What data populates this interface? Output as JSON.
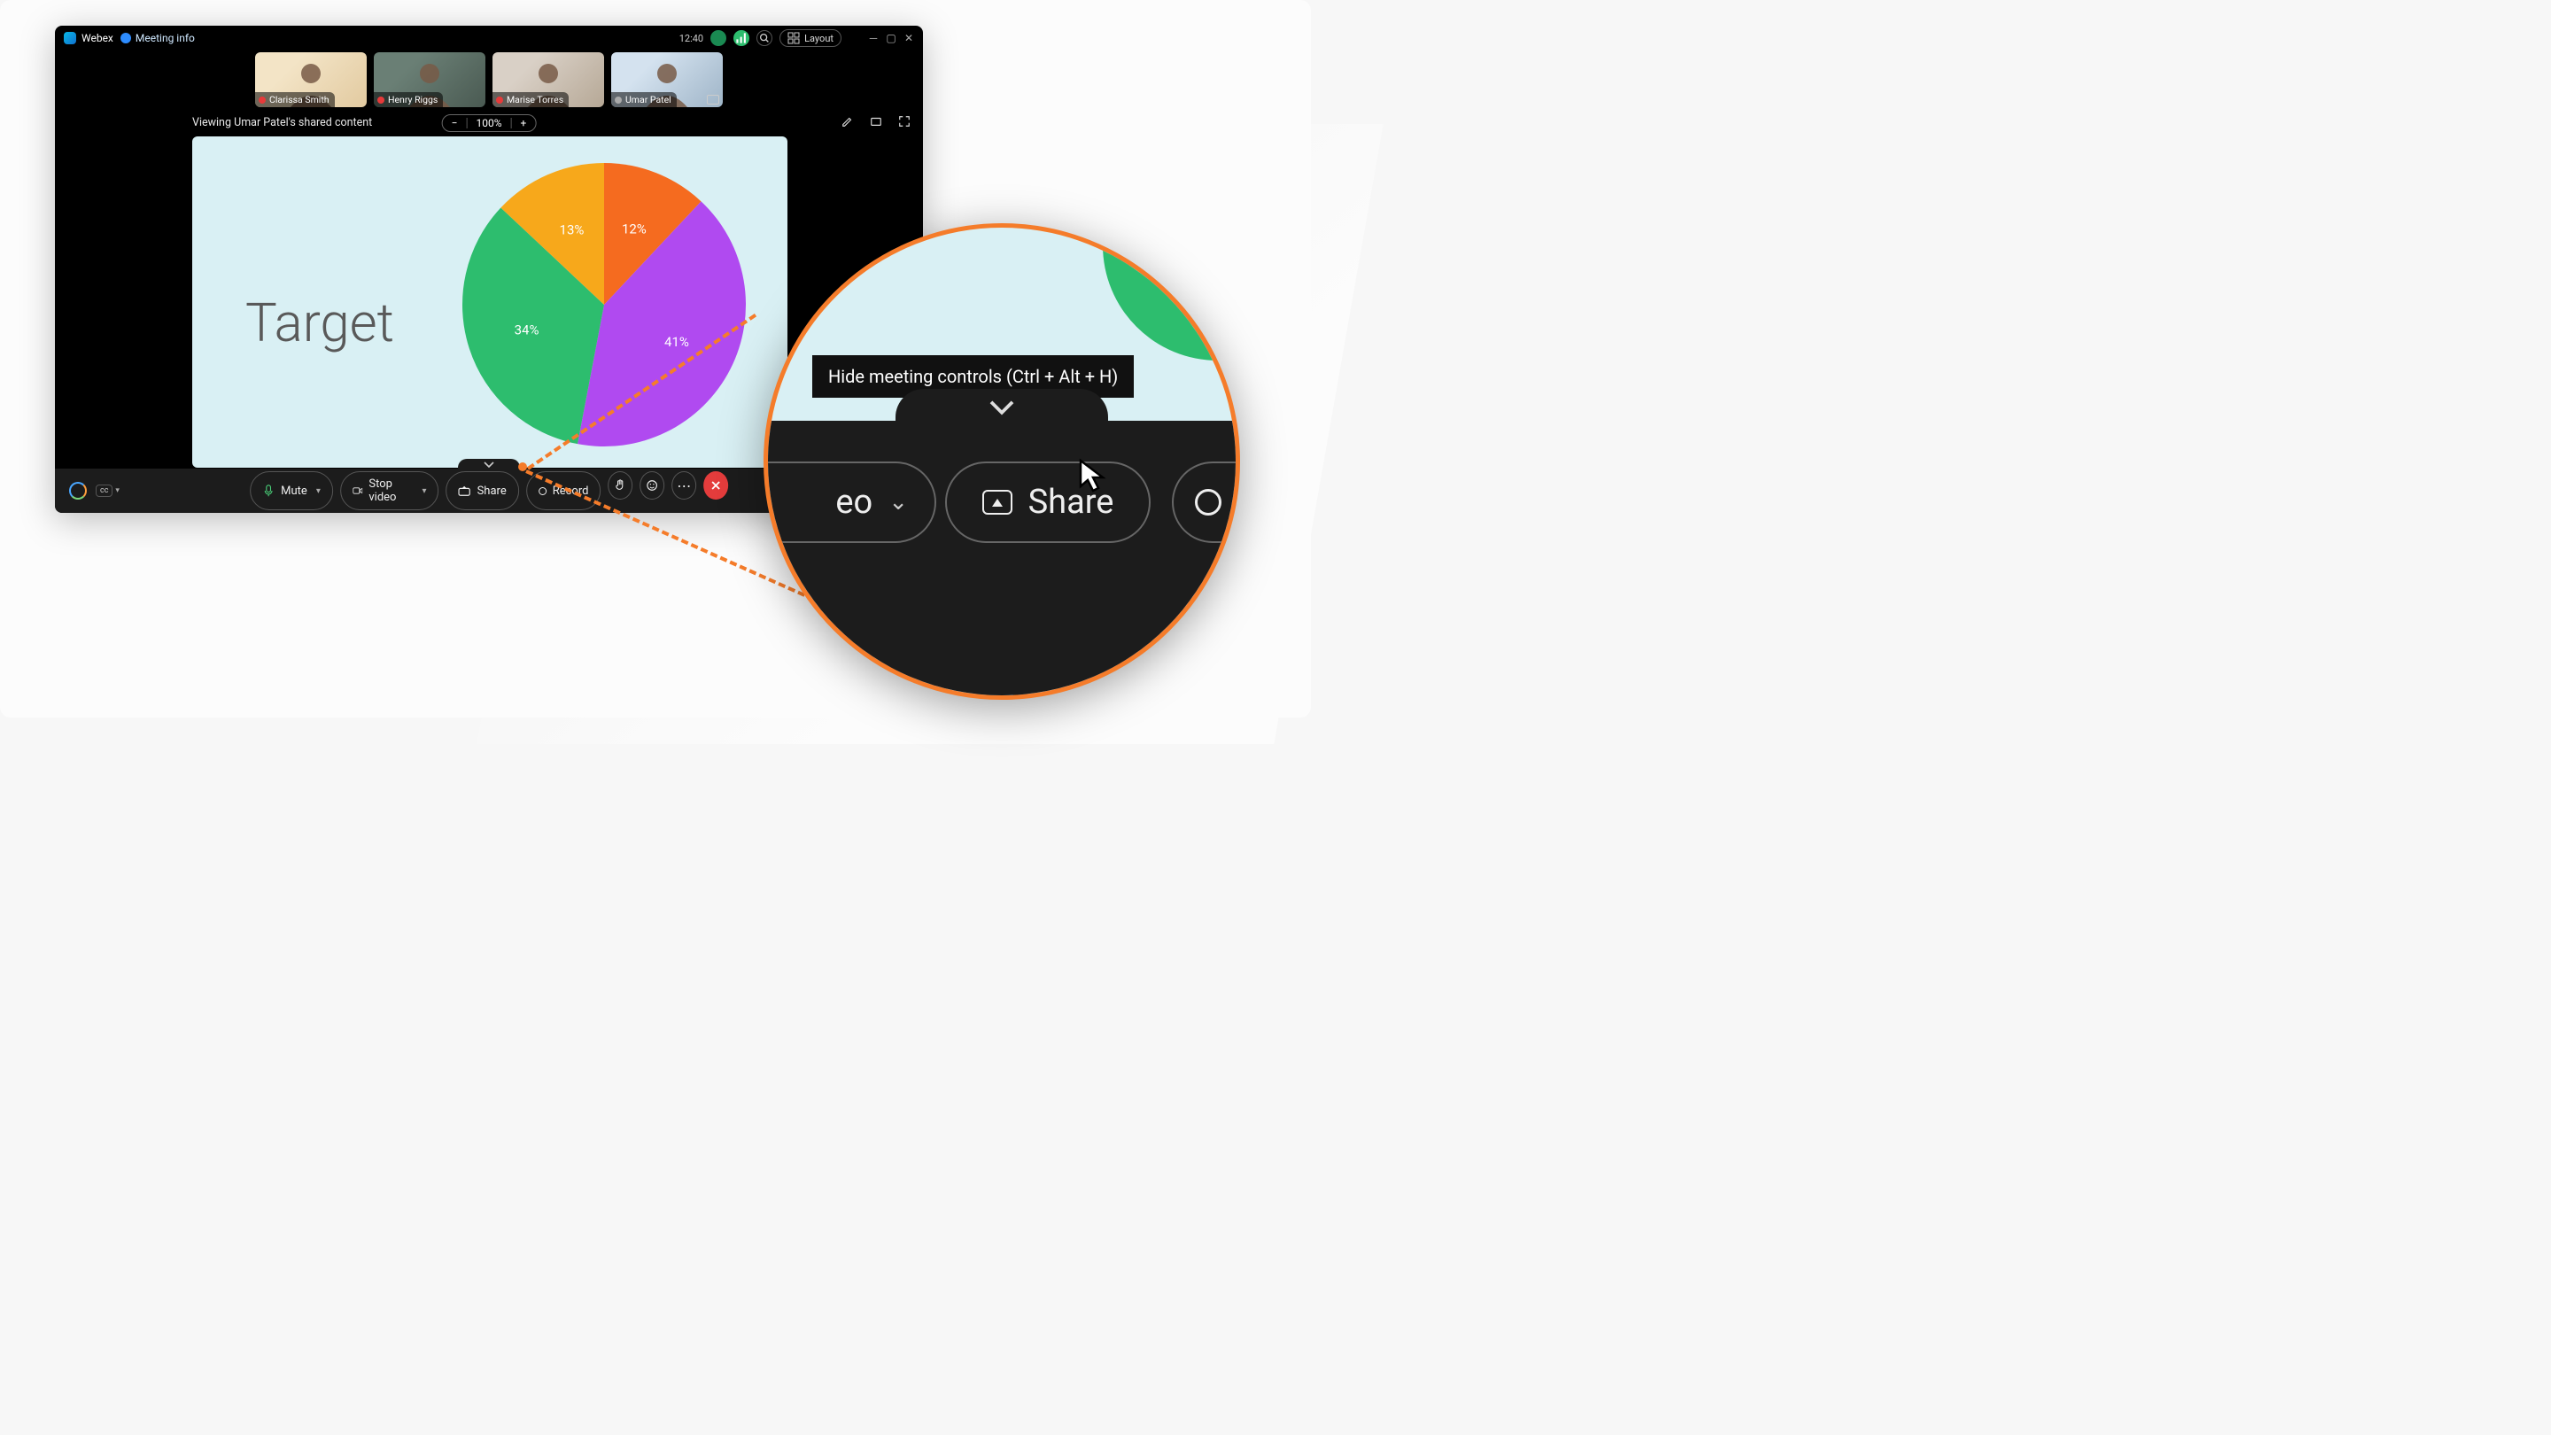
{
  "app_name": "Webex",
  "meeting_info_label": "Meeting info",
  "clock": "12:40",
  "layout_label": "Layout",
  "participants": [
    {
      "name": "Clarissa Smith",
      "muted": true,
      "bg": "linear-gradient(135deg,#f3e4c6 30%,#e2caa0)"
    },
    {
      "name": "Henry Riggs",
      "muted": true,
      "bg": "linear-gradient(135deg,#6a7f75 30%,#4a5a52)"
    },
    {
      "name": "Marise Torres",
      "muted": true,
      "bg": "linear-gradient(135deg,#d9d0c6 30%,#b6a896)"
    },
    {
      "name": "Umar Patel",
      "muted": false,
      "bg": "linear-gradient(135deg,#d4e2ef 30%,#9fb5c8)",
      "presenter": true
    }
  ],
  "viewing_label": "Viewing Umar Patel's shared content",
  "zoom_level": "100%",
  "shared": {
    "title": "Target"
  },
  "chart_data": {
    "type": "pie",
    "title": "Target",
    "slices": [
      {
        "label": "12%",
        "value": 12,
        "color": "#f56b1f"
      },
      {
        "label": "41%",
        "value": 41,
        "color": "#b04af0"
      },
      {
        "label": "34%",
        "value": 34,
        "color": "#2dbd6e"
      },
      {
        "label": "13%",
        "value": 13,
        "color": "#f7a81b"
      }
    ]
  },
  "controls": {
    "mute": "Mute",
    "stop_video": "Stop video",
    "share": "Share",
    "record": "Record"
  },
  "tooltip": "Hide meeting controls (Ctrl + Alt + H)",
  "callout": {
    "partial_left": "eo",
    "share": "Share"
  }
}
